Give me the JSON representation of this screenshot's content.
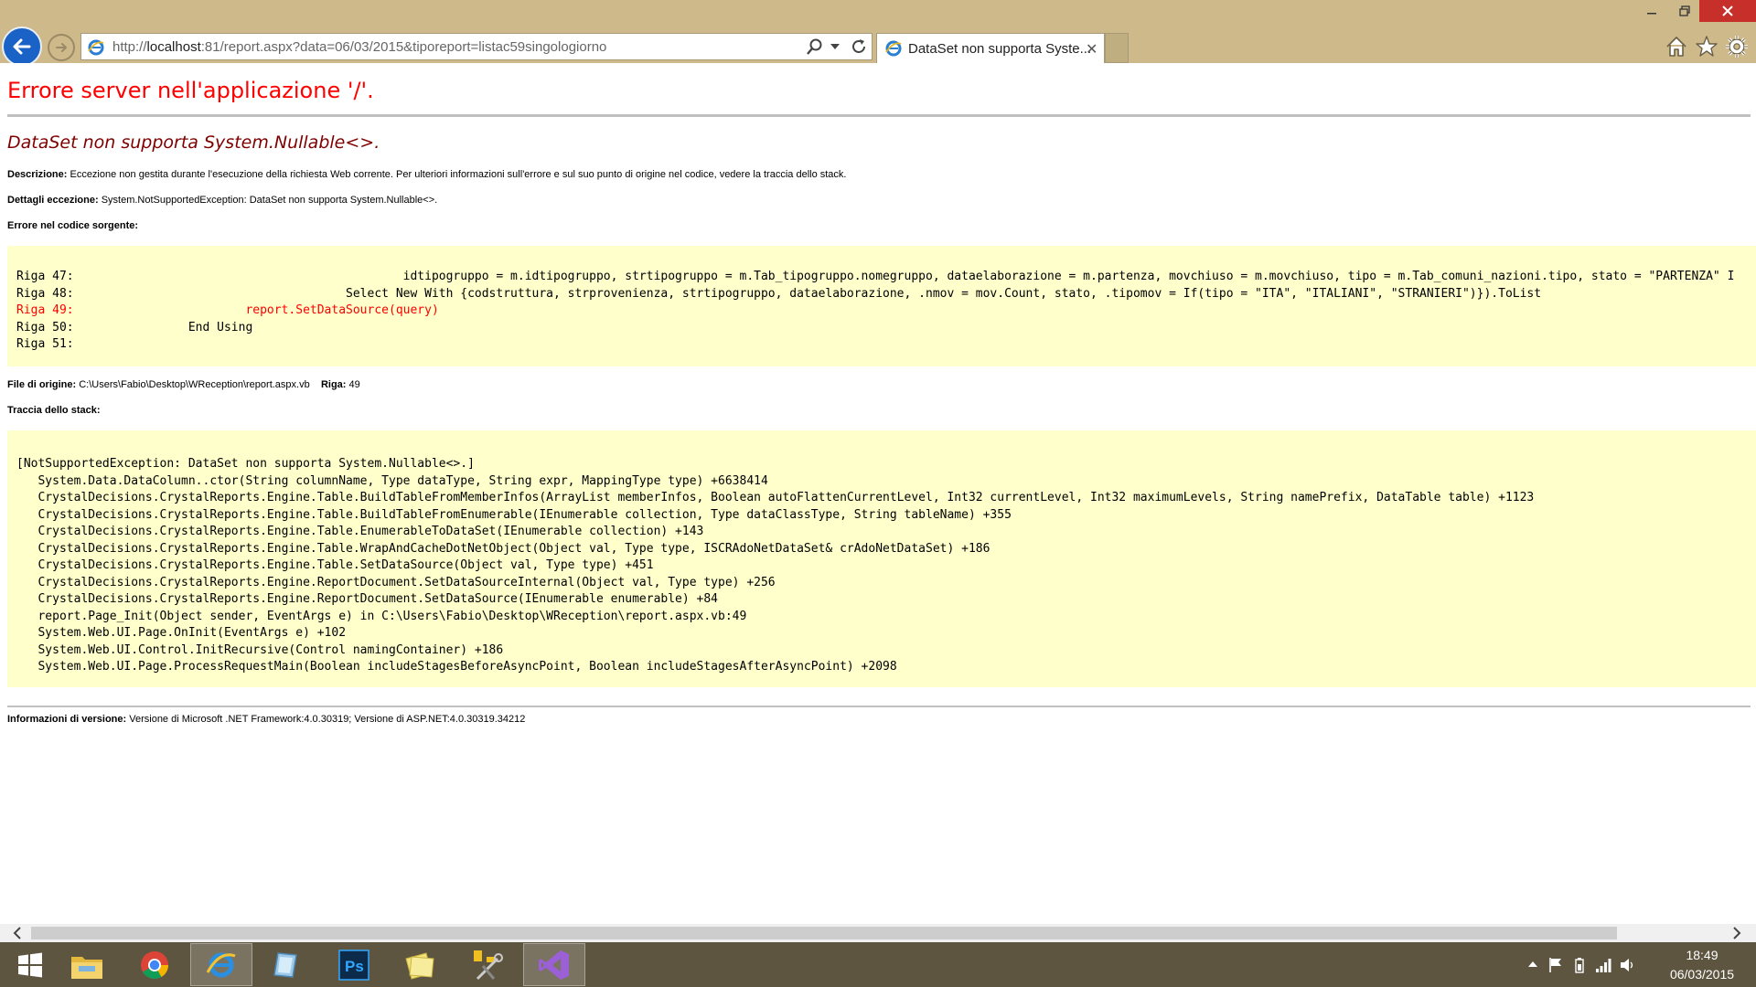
{
  "browser": {
    "address": {
      "prefix": "http://",
      "host": "localhost",
      "rest": ":81/report.aspx?data=06/03/2015&tiporeport=listac59singologiorno"
    },
    "tab_title": "DataSet non supporta Syste...",
    "tab_close_glyph": "✕"
  },
  "page": {
    "title": "Errore server nell'applicazione '/'.",
    "error_heading": "DataSet non supporta System.Nullable<>.",
    "description_label": "Descrizione:",
    "description_text": " Eccezione non gestita durante l'esecuzione della richiesta Web corrente. Per ulteriori informazioni sull'errore e sul suo punto di origine nel codice, vedere la traccia dello stack.",
    "exception_label": "Dettagli eccezione:",
    "exception_text": " System.NotSupportedException: DataSet non supporta System.Nullable<>.",
    "source_error_label": "Errore nel codice sorgente:",
    "source_lines": [
      {
        "text": "Riga 47:                                              idtipogruppo = m.idtipogruppo, strtipogruppo = m.Tab_tipogruppo.nomegruppo, dataelaborazione = m.partenza, movchiuso = m.movchiuso, tipo = m.Tab_comuni_nazioni.tipo, stato = \"PARTENZA\" I",
        "highlight": false
      },
      {
        "text": "Riga 48:                                      Select New With {codstruttura, strprovenienza, strtipogruppo, dataelaborazione, .nmov = mov.Count, stato, .tipomov = If(tipo = \"ITA\", \"ITALIANI\", \"STRANIERI\")}).ToList",
        "highlight": false
      },
      {
        "text": "Riga 49:                        report.SetDataSource(query)",
        "highlight": true
      },
      {
        "text": "Riga 50:                End Using",
        "highlight": false
      },
      {
        "text": "Riga 51: ",
        "highlight": false
      }
    ],
    "source_file_label": "File di origine:",
    "source_file_text": " C:\\Users\\Fabio\\Desktop\\WReception\\report.aspx.vb",
    "line_label": "Riga:",
    "line_value": " 49",
    "stack_label": "Traccia dello stack:",
    "stack_lines": [
      "[NotSupportedException: DataSet non supporta System.Nullable<>.]",
      "   System.Data.DataColumn..ctor(String columnName, Type dataType, String expr, MappingType type) +6638414",
      "   CrystalDecisions.CrystalReports.Engine.Table.BuildTableFromMemberInfos(ArrayList memberInfos, Boolean autoFlattenCurrentLevel, Int32 currentLevel, Int32 maximumLevels, String namePrefix, DataTable table) +1123",
      "   CrystalDecisions.CrystalReports.Engine.Table.BuildTableFromEnumerable(IEnumerable collection, Type dataClassType, String tableName) +355",
      "   CrystalDecisions.CrystalReports.Engine.Table.EnumerableToDataSet(IEnumerable collection) +143",
      "   CrystalDecisions.CrystalReports.Engine.Table.WrapAndCacheDotNetObject(Object val, Type type, ISCRAdoNetDataSet& crAdoNetDataSet) +186",
      "   CrystalDecisions.CrystalReports.Engine.Table.SetDataSource(Object val, Type type) +451",
      "   CrystalDecisions.CrystalReports.Engine.ReportDocument.SetDataSourceInternal(Object val, Type type) +256",
      "   CrystalDecisions.CrystalReports.Engine.ReportDocument.SetDataSource(IEnumerable enumerable) +84",
      "   report.Page_Init(Object sender, EventArgs e) in C:\\Users\\Fabio\\Desktop\\WReception\\report.aspx.vb:49",
      "   System.Web.UI.Page.OnInit(EventArgs e) +102",
      "   System.Web.UI.Control.InitRecursive(Control namingContainer) +186",
      "   System.Web.UI.Page.ProcessRequestMain(Boolean includeStagesBeforeAsyncPoint, Boolean includeStagesAfterAsyncPoint) +2098"
    ],
    "version_label": "Informazioni di versione:",
    "version_text": " Versione di Microsoft .NET Framework:4.0.30319; Versione di ASP.NET:4.0.30319.34212"
  },
  "taskbar": {
    "items": [
      {
        "name": "start",
        "icon": "windows-logo-icon"
      },
      {
        "name": "file-explorer",
        "icon": "folder-icon"
      },
      {
        "name": "chrome",
        "icon": "chrome-icon"
      },
      {
        "name": "internet-explorer",
        "icon": "internet-explorer-icon",
        "active": true
      },
      {
        "name": "app",
        "icon": "blue-glass-icon"
      },
      {
        "name": "photoshop",
        "icon": "photoshop-icon",
        "label": "Ps"
      },
      {
        "name": "sticky-notes",
        "icon": "sticky-notes-icon"
      },
      {
        "name": "tools",
        "icon": "tools-icon"
      },
      {
        "name": "visual-studio",
        "icon": "visual-studio-icon",
        "active": true
      }
    ],
    "clock_time": "18:49",
    "clock_date": "06/03/2015"
  },
  "colors": {
    "title": "#ff0000",
    "error_heading": "#800000",
    "code_background": "#ffffcc",
    "chrome_frame": "#cdb98a",
    "taskbar": "#5e5540"
  }
}
